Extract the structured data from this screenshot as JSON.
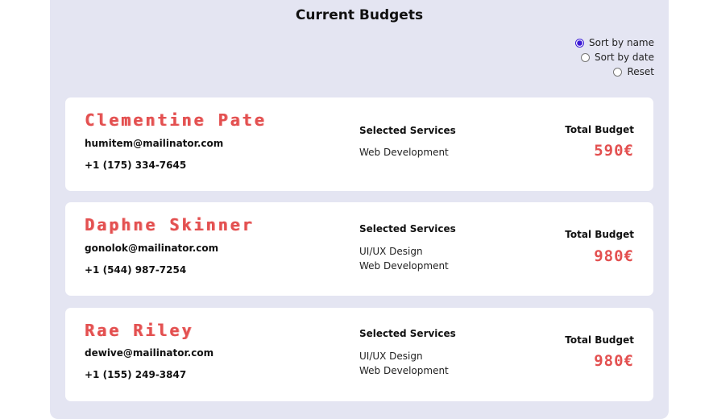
{
  "page": {
    "title": "Current Budgets"
  },
  "sort": {
    "options": [
      {
        "label": "Sort by name",
        "checked": true
      },
      {
        "label": "Sort by date",
        "checked": false
      },
      {
        "label": "Reset",
        "checked": false
      }
    ]
  },
  "budgets": [
    {
      "name": "Clementine Pate",
      "email": "humitem@mailinator.com",
      "phone": "+1 (175) 334-7645",
      "services_heading": "Selected Services",
      "services": [
        "Web Development"
      ],
      "total_heading": "Total Budget",
      "total": "590€"
    },
    {
      "name": "Daphne Skinner",
      "email": "gonolok@mailinator.com",
      "phone": "+1 (544) 987-7254",
      "services_heading": "Selected Services",
      "services": [
        "UI/UX Design",
        "Web Development"
      ],
      "total_heading": "Total Budget",
      "total": "980€"
    },
    {
      "name": "Rae Riley",
      "email": "dewive@mailinator.com",
      "phone": "+1 (155) 249-3847",
      "services_heading": "Selected Services",
      "services": [
        "UI/UX Design",
        "Web Development"
      ],
      "total_heading": "Total Budget",
      "total": "980€"
    }
  ]
}
